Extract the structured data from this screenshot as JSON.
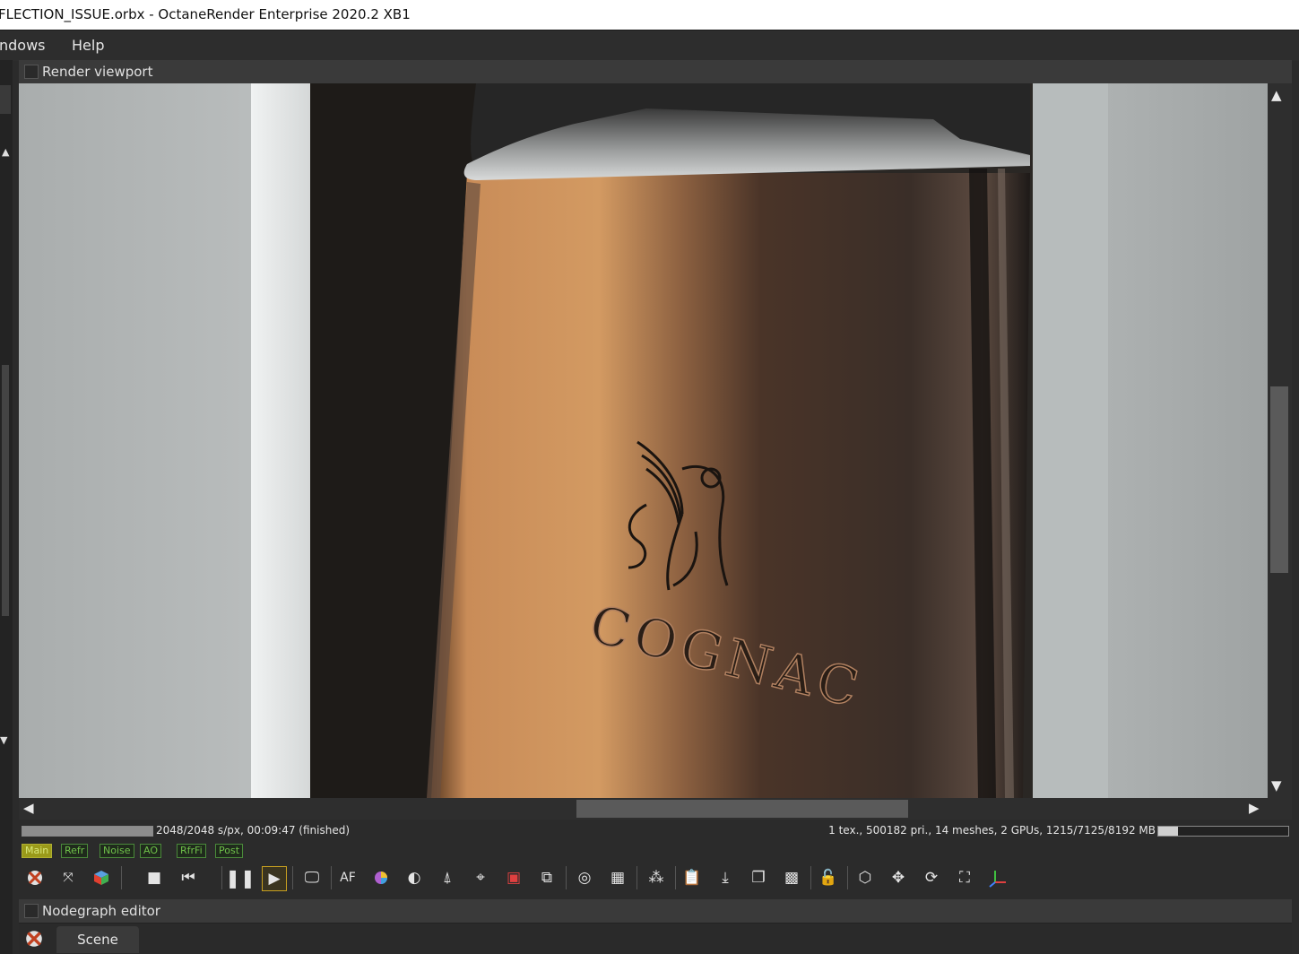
{
  "window": {
    "title": "FLECTION_ISSUE.orbx - OctaneRender Enterprise 2020.2 XB1"
  },
  "menu": {
    "items": [
      "ndows",
      "Help"
    ]
  },
  "render_panel": {
    "title": "Render viewport"
  },
  "render_image": {
    "bottle_emboss_text": "COGNAC"
  },
  "status": {
    "progress_text": "2048/2048 s/px, 00:09:47 (finished)",
    "progress_fraction": 1.0,
    "stats_text": "1 tex., 500182 pri., 14 meshes, 2 GPUs, 1215/7125/8192 MB",
    "memory_fraction": 0.15
  },
  "passes": [
    "Main",
    "Refr",
    "Noise",
    "AO",
    "RfrFi",
    "Post"
  ],
  "toolbar": {
    "af_label": "AF"
  },
  "nodegraph": {
    "title": "Nodegraph editor",
    "tab": "Scene"
  },
  "colors": {
    "accent_yellow": "#9a9a1a",
    "pass_green": "#6fc04a",
    "panel_bg": "#2b2b2b"
  }
}
